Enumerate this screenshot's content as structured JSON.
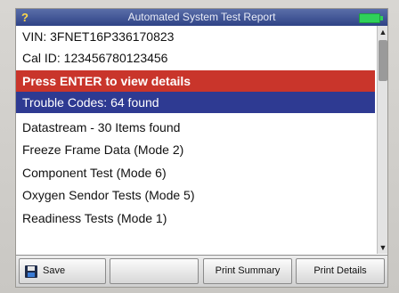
{
  "header": {
    "help_glyph": "?",
    "title": "Automated System Test Report",
    "battery_icon": "battery-icon"
  },
  "list": {
    "items": [
      {
        "label": "VIN: 3FNET16P336170823",
        "style": "normal"
      },
      {
        "label": "Cal ID: 123456780123456",
        "style": "normal"
      },
      {
        "label": "Press ENTER to view details",
        "style": "banner"
      },
      {
        "label": "Trouble Codes: 64 found",
        "style": "selected"
      },
      {
        "label": "Datastream - 30 Items found",
        "style": "normal"
      },
      {
        "label": "Freeze Frame Data (Mode 2)",
        "style": "normal"
      },
      {
        "label": "Component Test (Mode 6)",
        "style": "normal"
      },
      {
        "label": "Oxygen Sendor Tests (Mode 5)",
        "style": "normal"
      },
      {
        "label": "Readiness Tests (Mode 1)",
        "style": "normal"
      }
    ]
  },
  "toolbar": {
    "save_label": "Save",
    "blank_label": "",
    "print_summary_label": "Print Summary",
    "print_details_label": "Print Details"
  },
  "colors": {
    "banner": "#c9352b",
    "selected": "#2e3a92",
    "titlebar": "#3a4f92"
  }
}
